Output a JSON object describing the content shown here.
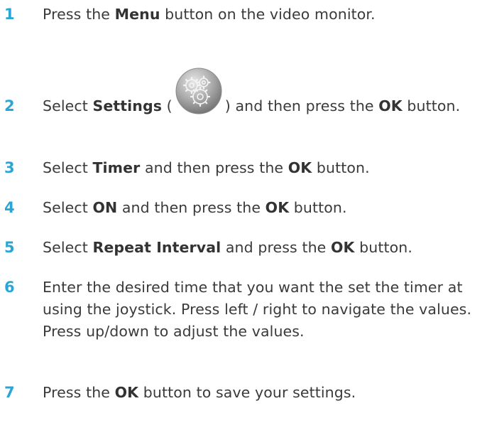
{
  "steps": [
    {
      "number": "1",
      "parts": [
        {
          "t": "Press the "
        },
        {
          "b": "Menu"
        },
        {
          "t": " button on the video monitor."
        }
      ]
    },
    {
      "number": "2",
      "parts": [
        {
          "t": "Select "
        },
        {
          "b": "Settings"
        },
        {
          "t": " ("
        },
        {
          "icon": "settings-gear-icon"
        },
        {
          "t": ") and then press the "
        },
        {
          "b": "OK"
        },
        {
          "t": " button."
        }
      ]
    },
    {
      "number": "3",
      "parts": [
        {
          "t": "Select "
        },
        {
          "b": "Timer"
        },
        {
          "t": " and then press the "
        },
        {
          "b": "OK"
        },
        {
          "t": " button."
        }
      ]
    },
    {
      "number": "4",
      "parts": [
        {
          "t": "Select "
        },
        {
          "b": "ON"
        },
        {
          "t": " and then press the "
        },
        {
          "b": "OK"
        },
        {
          "t": " button."
        }
      ]
    },
    {
      "number": "5",
      "parts": [
        {
          "t": "Select "
        },
        {
          "b": "Repeat Interval"
        },
        {
          "t": " and press the "
        },
        {
          "b": "OK"
        },
        {
          "t": " button."
        }
      ]
    },
    {
      "number": "6",
      "parts": [
        {
          "t": "Enter the desired time that you want the set the timer at using the joystick. Press left / right to navigate the values. Press up/down to adjust the values."
        }
      ]
    },
    {
      "number": "7",
      "parts": [
        {
          "t": "Press the "
        },
        {
          "b": "OK"
        },
        {
          "t": " button to save your settings."
        }
      ]
    }
  ],
  "colors": {
    "step_number": "#2aa6d6",
    "body_text": "#3a3a3a"
  }
}
